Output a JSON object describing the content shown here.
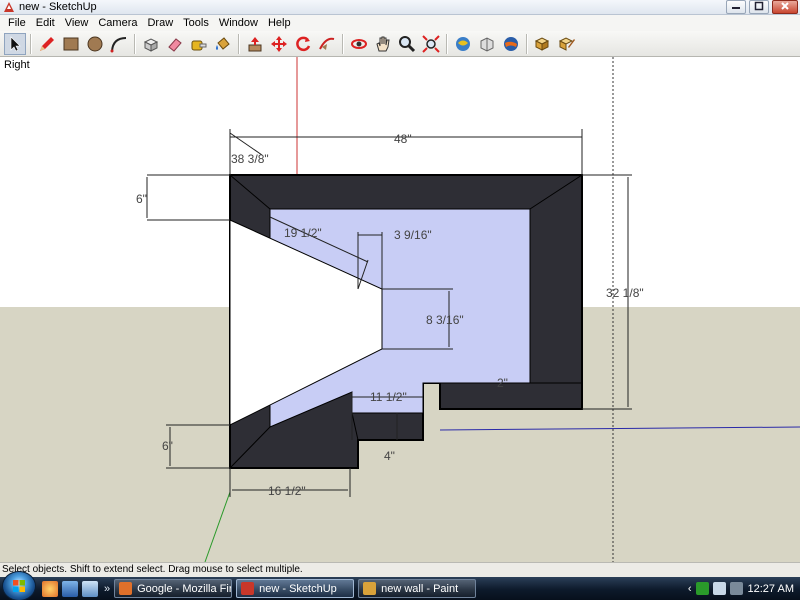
{
  "window": {
    "title": "new - SketchUp"
  },
  "menu": [
    "File",
    "Edit",
    "View",
    "Camera",
    "Draw",
    "Tools",
    "Window",
    "Help"
  ],
  "toolbar": {
    "tools": [
      "select-tool-icon",
      "pencil-tool-icon",
      "rectangle-tool-icon",
      "circle-tool-icon",
      "arc-tool-icon",
      "make-component-icon",
      "eraser-tool-icon",
      "tape-measure-icon",
      "paint-bucket-icon",
      "push-pull-icon",
      "move-tool-icon",
      "rotate-tool-icon",
      "follow-me-icon",
      "orbit-tool-icon",
      "pan-tool-icon",
      "zoom-tool-icon",
      "zoom-extents-icon",
      "get-models-icon",
      "share-model-icon",
      "google-earth-icon",
      "component-browser-icon",
      "materials-icon"
    ]
  },
  "view": {
    "label": "Right"
  },
  "dimensions": {
    "top_width": "48\"",
    "top_left_offset": "38 3/8\"",
    "left_upper": "6\"",
    "slope_length": "19 1/2\"",
    "slot_width": "3 9/16\"",
    "slot_height": "8 3/16\"",
    "right_height": "32 1/8\"",
    "step_length": "11 1/2\"",
    "left_lower": "6\"",
    "step_height": "4\"",
    "bottom_width": "16 1/2\"",
    "hidden_label": "2\""
  },
  "status": {
    "text": "Select objects. Shift to extend select. Drag mouse to select multiple."
  },
  "taskbar": {
    "items": [
      {
        "label": "Google - Mozilla Fir...",
        "color": "#e0702a"
      },
      {
        "label": "new - SketchUp",
        "color": "#c8372a"
      },
      {
        "label": "new wall - Paint",
        "color": "#d9a23a"
      }
    ],
    "chevron": "»",
    "tray_arrow": "‹",
    "clock": "12:27 AM"
  }
}
